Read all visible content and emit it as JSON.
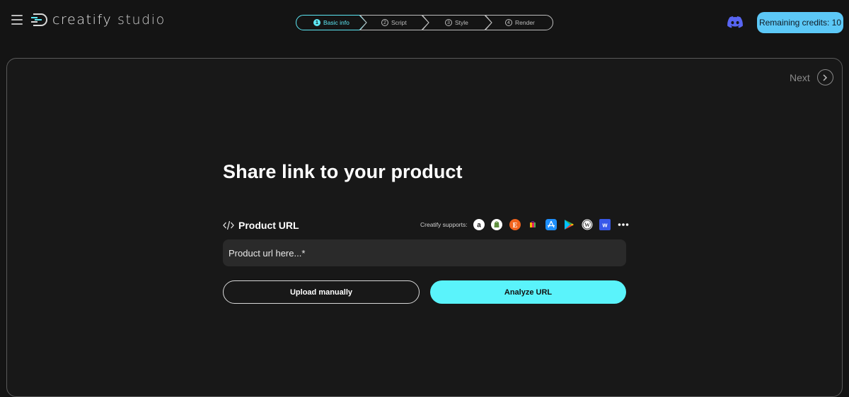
{
  "header": {
    "logo_brand": "creatify",
    "logo_suffix": "studio",
    "steps": [
      {
        "num": "1",
        "label": "Basic info"
      },
      {
        "num": "2",
        "label": "Script"
      },
      {
        "num": "3",
        "label": "Style"
      },
      {
        "num": "4",
        "label": "Render"
      }
    ],
    "credits_label": "Remaining credits: 10"
  },
  "panel": {
    "next_label": "Next",
    "title": "Share link to your product",
    "url_label": "Product URL",
    "supports_label": "Creatify supports:",
    "supported_platforms": [
      "amazon-icon",
      "shopify-icon",
      "etsy-icon",
      "app-icon",
      "app-store-icon",
      "google-play-icon",
      "wordpress-icon",
      "wix-icon",
      "more-icon"
    ],
    "url_placeholder": "Product url here...*",
    "upload_label": "Upload manually",
    "analyze_label": "Analyze URL"
  },
  "colors": {
    "accent": "#5af3fb",
    "credits_bg": "#5cc8f7",
    "background": "#141414"
  }
}
